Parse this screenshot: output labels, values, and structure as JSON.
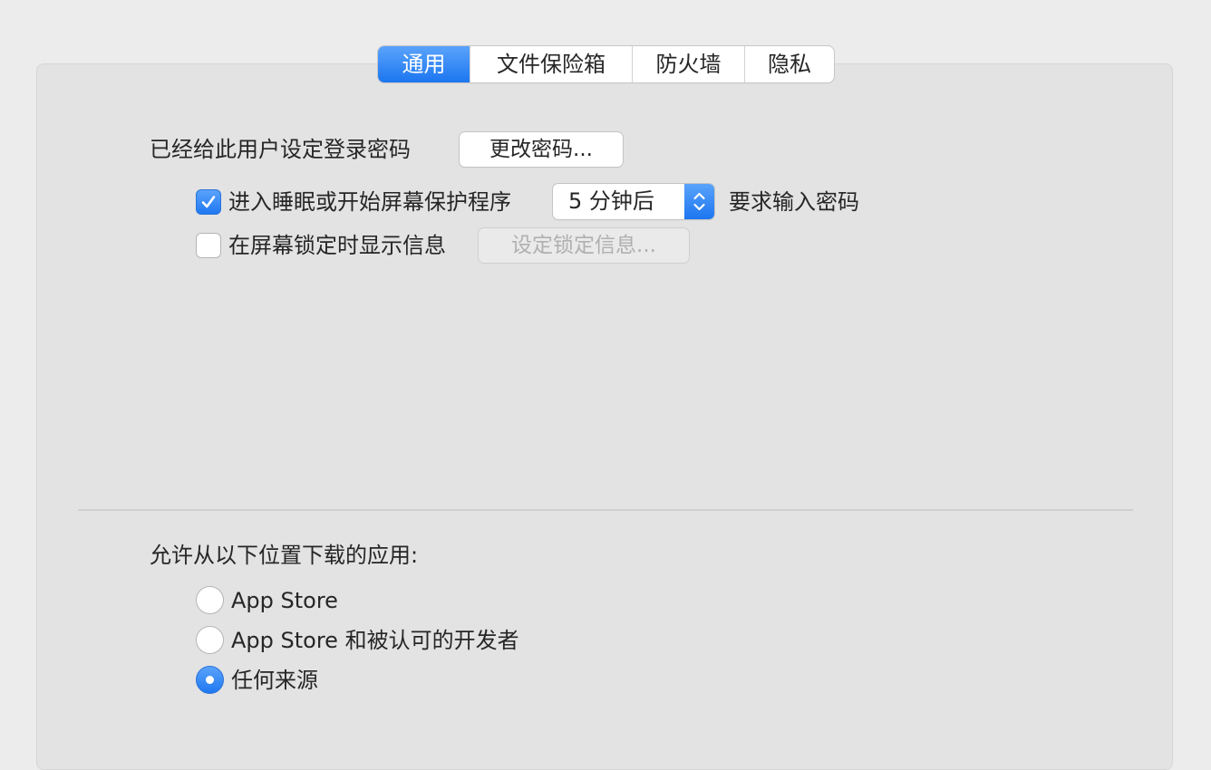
{
  "tabs": [
    {
      "label": "通用",
      "selected": true
    },
    {
      "label": "文件保险箱",
      "selected": false
    },
    {
      "label": "防火墙",
      "selected": false
    },
    {
      "label": "隐私",
      "selected": false
    }
  ],
  "login": {
    "label": "已经给此用户设定登录密码",
    "change_password_button": "更改密码..."
  },
  "require_password": {
    "checked": true,
    "label": "进入睡眠或开始屏幕保护程序",
    "delay_value": "5 分钟后",
    "suffix": "要求输入密码"
  },
  "lock_message": {
    "checked": false,
    "label": "在屏幕锁定时显示信息",
    "set_message_button": "设定锁定信息..."
  },
  "downloads": {
    "heading": "允许从以下位置下载的应用:",
    "options": [
      {
        "label": "App Store",
        "selected": false
      },
      {
        "label": "App Store 和被认可的开发者",
        "selected": false
      },
      {
        "label": "任何来源",
        "selected": true
      }
    ]
  },
  "colors": {
    "accent": "#1c76f0",
    "pane_bg": "#e3e3e3",
    "window_bg": "#ececec"
  }
}
